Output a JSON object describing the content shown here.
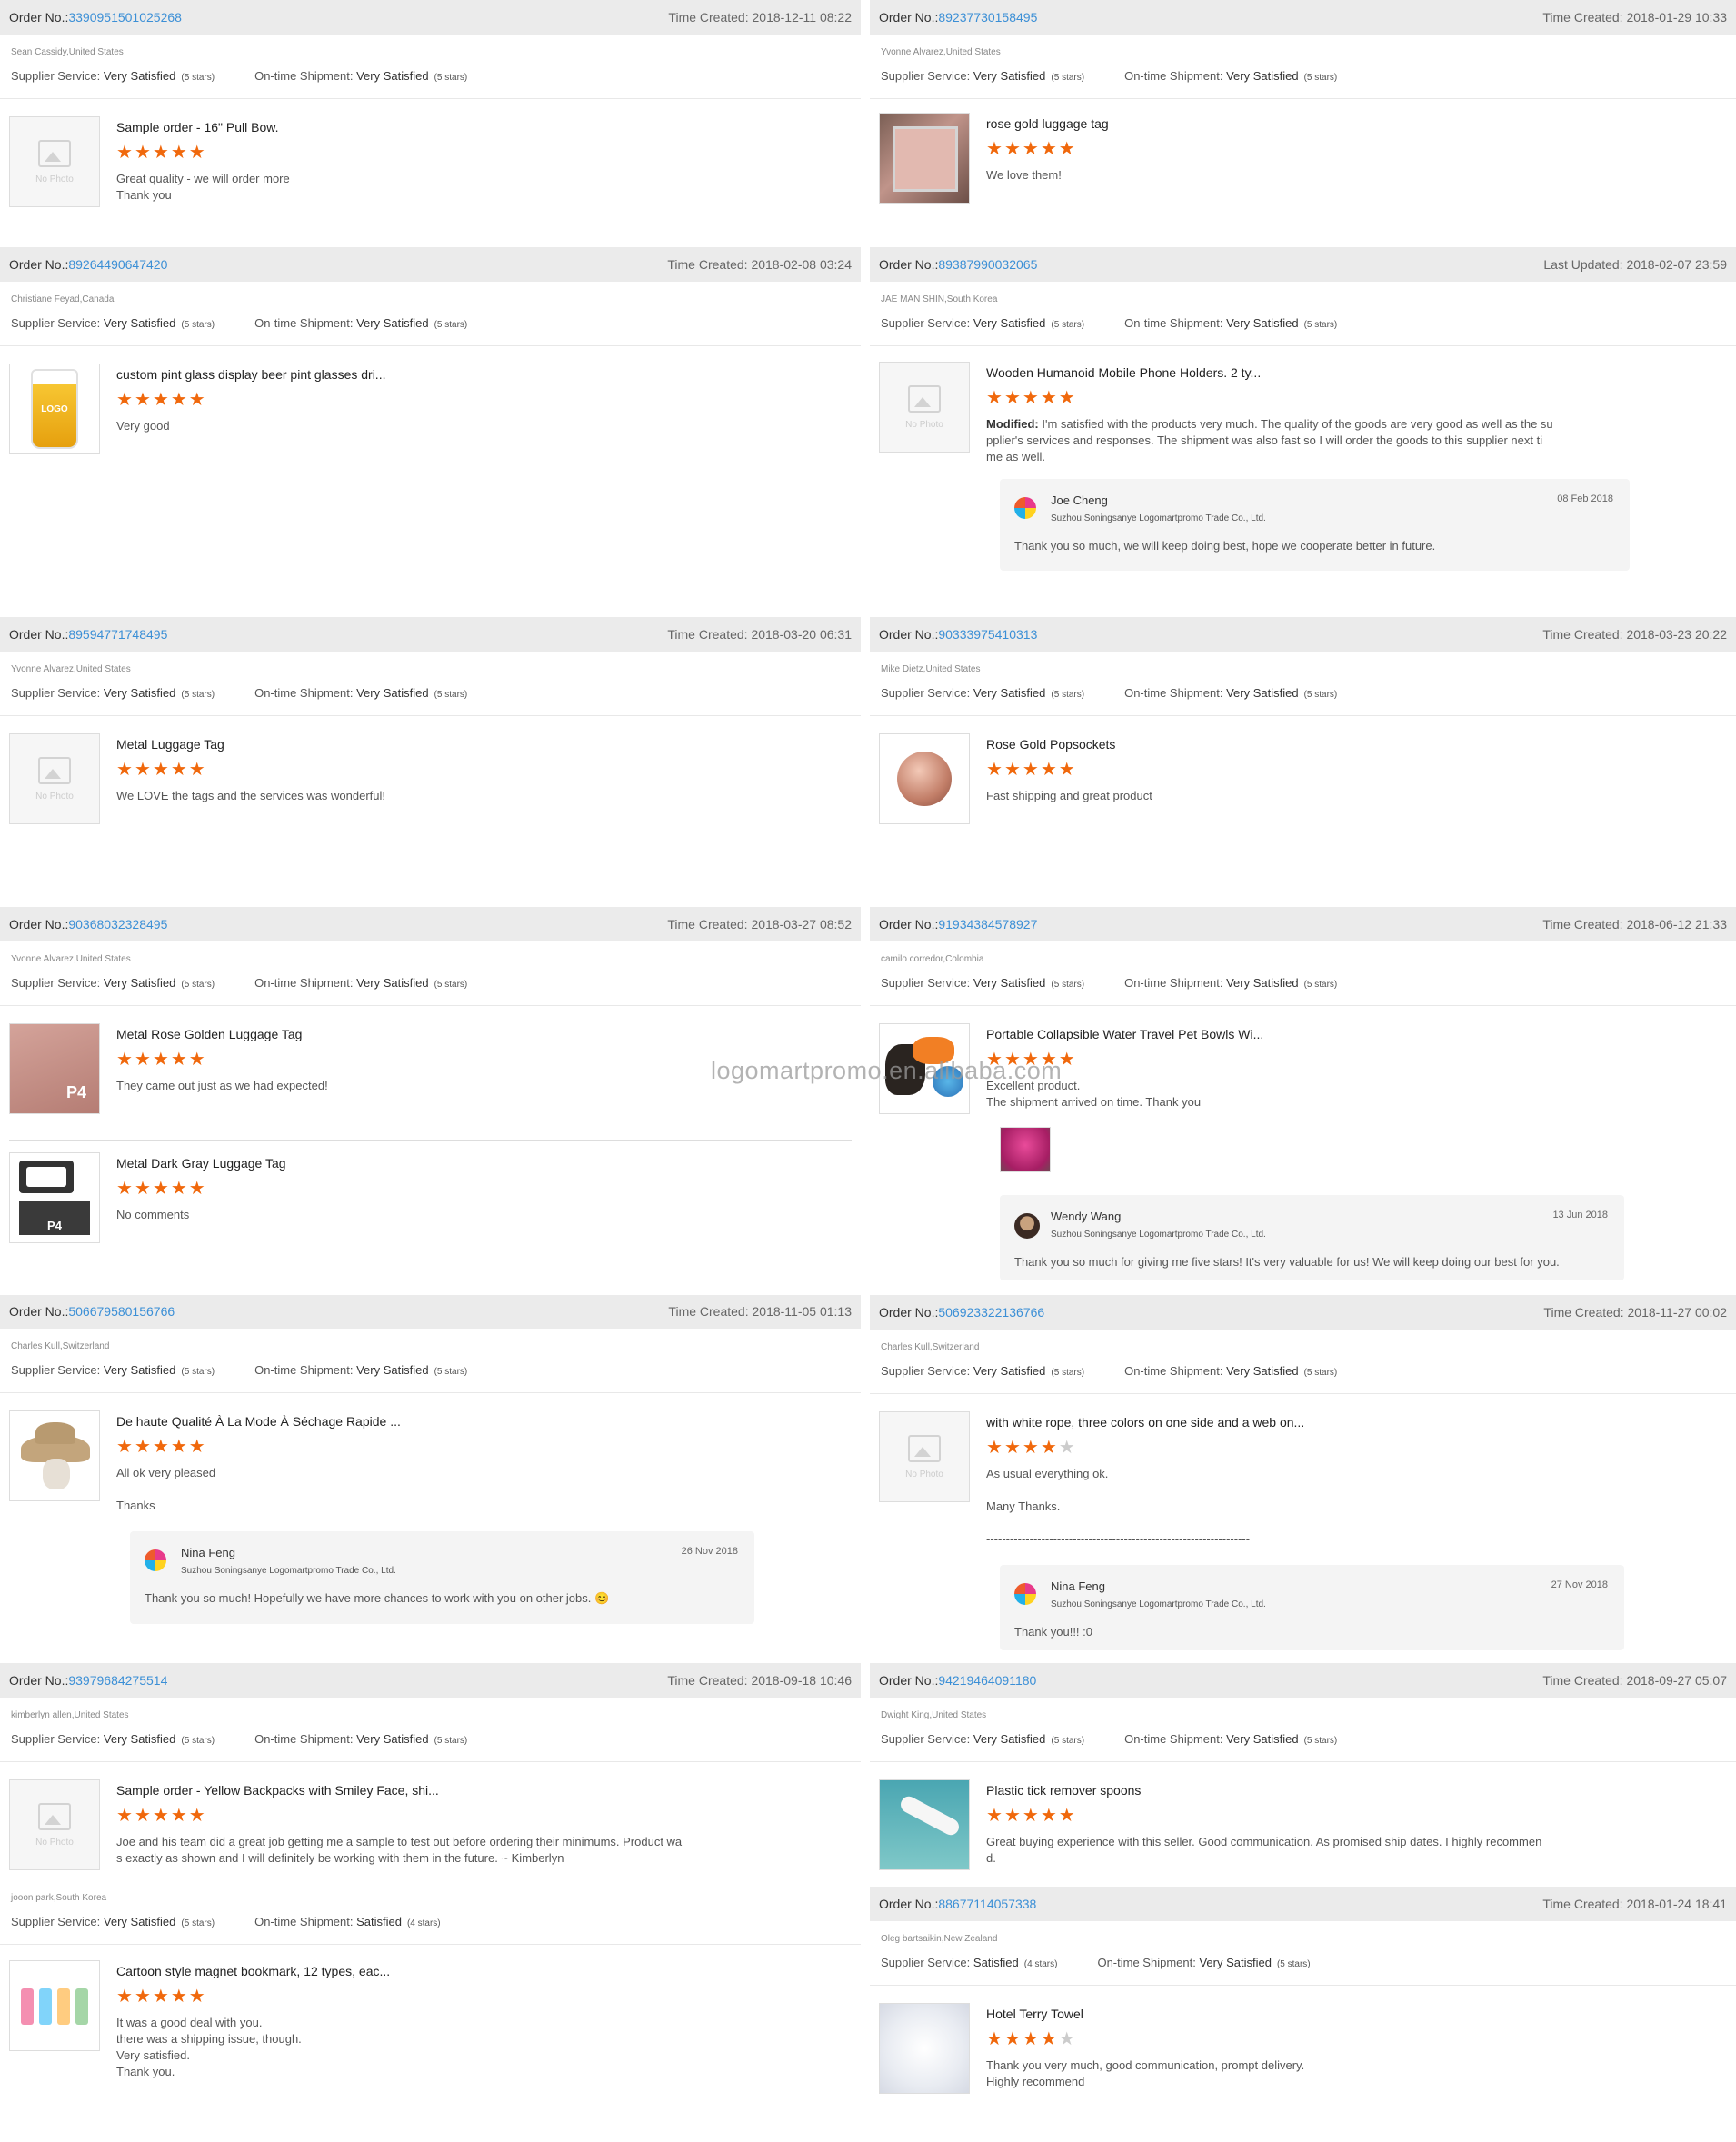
{
  "labels": {
    "order": "Order No.:",
    "supplier": "Supplier Service:",
    "shipment": "On-time Shipment:",
    "company": "Suzhou Soningsanye Logomartpromo Trade Co., Ltd.",
    "nophoto": "No Photo"
  },
  "watermark": "logomartpromo.en.alibaba.com",
  "colors": {
    "accent": "#3b8fd6",
    "star": "#f0680c",
    "header": "#ebebeb"
  },
  "orders": [
    {
      "no": "3390951501025268",
      "timelabel": "Time Created:",
      "time": "2018-12-11 08:22",
      "buyer": "Sean Cassidy,United States",
      "supplier": "Very Satisfied",
      "supplier_stars": "(5 stars)",
      "shipment": "Very Satisfied",
      "shipment_stars": "(5 stars)",
      "items": [
        {
          "title": "Sample order - 16\" Pull Bow.",
          "rating": 5,
          "comment": "Great quality - we will order more\nThank you",
          "image": "no-photo"
        }
      ]
    },
    {
      "no": "89237730158495",
      "timelabel": "Time Created:",
      "time": "2018-01-29 10:33",
      "buyer": "Yvonne Alvarez,United States",
      "supplier": "Very Satisfied",
      "supplier_stars": "(5 stars)",
      "shipment": "Very Satisfied",
      "shipment_stars": "(5 stars)",
      "items": [
        {
          "title": "rose gold luggage tag",
          "rating": 5,
          "comment": "We love them!",
          "image": "luggage-tag-photo"
        }
      ]
    },
    {
      "no": "89264490647420",
      "timelabel": "Time Created:",
      "time": "2018-02-08 03:24",
      "buyer": "Christiane Feyad,Canada",
      "supplier": "Very Satisfied",
      "supplier_stars": "(5 stars)",
      "shipment": "Very Satisfied",
      "shipment_stars": "(5 stars)",
      "items": [
        {
          "title": "custom pint glass display beer pint glasses dri...",
          "rating": 5,
          "comment": "Very good",
          "image": "pint-glass-photo",
          "image_text": "LOGO"
        }
      ]
    },
    {
      "no": "89387990032065",
      "timelabel": "Last Updated:",
      "time": "2018-02-07 23:59",
      "buyer": "JAE MAN SHIN,South Korea",
      "supplier": "Very Satisfied",
      "supplier_stars": "(5 stars)",
      "shipment": "Very Satisfied",
      "shipment_stars": "(5 stars)",
      "items": [
        {
          "title": "Wooden Humanoid Mobile Phone Holders. 2 ty...",
          "rating": 5,
          "comment_prefix": "Modified:",
          "comment": "I'm satisfied with the products very much.  The quality of the goods are very good as well as the su\npplier's services and responses.  The shipment was also fast so I will order the goods to this supplier next ti\nme as well.",
          "image": "no-photo"
        }
      ],
      "reply": {
        "name": "Joe Cheng",
        "date": "08 Feb 2018",
        "text": "Thank you so much, we will keep doing best, hope we cooperate better in future."
      }
    },
    {
      "no": "89594771748495",
      "timelabel": "Time Created:",
      "time": "2018-03-20 06:31",
      "buyer": "Yvonne Alvarez,United States",
      "supplier": "Very Satisfied",
      "supplier_stars": "(5 stars)",
      "shipment": "Very Satisfied",
      "shipment_stars": "(5 stars)",
      "items": [
        {
          "title": "Metal Luggage Tag",
          "rating": 5,
          "comment": "We LOVE the tags and the services was wonderful!",
          "image": "no-photo"
        }
      ]
    },
    {
      "no": "90333975410313",
      "timelabel": "Time Created:",
      "time": "2018-03-23 20:22",
      "buyer": "Mike Dietz,United States",
      "supplier": "Very Satisfied",
      "supplier_stars": "(5 stars)",
      "shipment": "Very Satisfied",
      "shipment_stars": "(5 stars)",
      "items": [
        {
          "title": "Rose Gold Popsockets",
          "rating": 5,
          "comment": "Fast shipping and great product",
          "image": "popsocket-photo"
        }
      ]
    },
    {
      "no": "90368032328495",
      "timelabel": "Time Created:",
      "time": "2018-03-27 08:52",
      "buyer": "Yvonne Alvarez,United States",
      "supplier": "Very Satisfied",
      "supplier_stars": "(5 stars)",
      "shipment": "Very Satisfied",
      "shipment_stars": "(5 stars)",
      "items": [
        {
          "title": "Metal Rose Golden Luggage Tag",
          "rating": 5,
          "comment": "They came out just as we had expected!",
          "image": "rose-tag-photo",
          "image_text": "P4"
        },
        {
          "title": "Metal Dark Gray Luggage Tag",
          "rating": 5,
          "comment": "No comments",
          "image": "gray-tag-photo",
          "image_text": "P4"
        }
      ]
    },
    {
      "no": "91934384578927",
      "timelabel": "Time Created:",
      "time": "2018-06-12 21:33",
      "buyer": "camilo corredor,Colombia",
      "supplier": "Very Satisfied",
      "supplier_stars": "(5 stars)",
      "shipment": "Very Satisfied",
      "shipment_stars": "(5 stars)",
      "items": [
        {
          "title": "Portable Collapsible Water Travel Pet Bowls Wi...",
          "rating": 5,
          "comment": "Excellent product.\nThe shipment arrived on time. Thank you",
          "image": "pet-bowl-photo"
        }
      ],
      "reply": {
        "name": "Wendy Wang",
        "date": "13 Jun 2018",
        "text": "Thank you so much for giving me five stars! It's very valuable for us! We will keep doing our best for you."
      }
    },
    {
      "no": "506679580156766",
      "timelabel": "Time Created:",
      "time": "2018-11-05 01:13",
      "buyer": "Charles Kull,Switzerland",
      "supplier": "Very Satisfied",
      "supplier_stars": "(5 stars)",
      "shipment": "Very Satisfied",
      "shipment_stars": "(5 stars)",
      "items": [
        {
          "title": "De haute Qualité À La Mode À Séchage Rapide ...",
          "rating": 5,
          "comment": "All ok very pleased\n\nThanks",
          "image": "hat-photo"
        }
      ],
      "reply": {
        "name": "Nina Feng",
        "date": "26 Nov 2018",
        "text": "Thank you so much! Hopefully we have more chances to work with you on other jobs. 😊"
      }
    },
    {
      "no": "506923322136766",
      "timelabel": "Time Created:",
      "time": "2018-11-27 00:02",
      "buyer": "Charles Kull,Switzerland",
      "supplier": "Very Satisfied",
      "supplier_stars": "(5 stars)",
      "shipment": "Very Satisfied",
      "shipment_stars": "(5 stars)",
      "items": [
        {
          "title": "with white rope, three colors on one side and a web on...",
          "rating": 4,
          "comment": "As usual everything ok.\n\nMany Thanks.\n\n-------------------------------------------------------------------",
          "image": "no-photo"
        }
      ],
      "reply": {
        "name": "Nina Feng",
        "date": "27 Nov 2018",
        "text": "Thank you!!!  :0"
      }
    },
    {
      "no": "93979684275514",
      "timelabel": "Time Created:",
      "time": "2018-09-18 10:46",
      "buyer": "kimberlyn allen,United States",
      "supplier": "Very Satisfied",
      "supplier_stars": "(5 stars)",
      "shipment": "Very Satisfied",
      "shipment_stars": "(5 stars)",
      "items": [
        {
          "title": "Sample order - Yellow Backpacks with Smiley Face, shi...",
          "rating": 5,
          "comment": "Joe and his team did a great job getting me a sample to test out before ordering their minimums. Product wa\ns exactly as shown and I will definitely be working with them in the future. ~ Kimberlyn",
          "image": "no-photo"
        }
      ]
    },
    {
      "no": "94219464091180",
      "timelabel": "Time Created:",
      "time": "2018-09-27 05:07",
      "buyer": "Dwight King,United States",
      "supplier": "Very Satisfied",
      "supplier_stars": "(5 stars)",
      "shipment": "Very Satisfied",
      "shipment_stars": "(5 stars)",
      "items": [
        {
          "title": "Plastic tick remover spoons",
          "rating": 5,
          "comment": "Great buying experience with this seller. Good communication. As promised ship dates. I highly recommen\nd.",
          "image": "spoon-photo"
        }
      ]
    },
    {
      "no": "",
      "timelabel": "",
      "time": "",
      "buyer": "jooon park,South Korea",
      "supplier": "Very Satisfied",
      "supplier_stars": "(5 stars)",
      "shipment": "Satisfied",
      "shipment_stars": "(4 stars)",
      "items": [
        {
          "title": "Cartoon style magnet bookmark, 12 types, eac...",
          "rating": 5,
          "comment": "It was a good deal with you.\nthere was a shipping issue, though.\nVery satisfied.\nThank you.",
          "image": "bookmark-photo"
        }
      ]
    },
    {
      "no": "88677114057338",
      "timelabel": "Time Created:",
      "time": "2018-01-24 18:41",
      "buyer": "Oleg bartsaikin,New Zealand",
      "supplier": "Satisfied",
      "supplier_stars": "(4 stars)",
      "shipment": "Very Satisfied",
      "shipment_stars": "(5 stars)",
      "items": [
        {
          "title": "Hotel Terry Towel",
          "rating": 4,
          "comment": "Thank you very much, good communication, prompt delivery.\nHighly recommend",
          "image": "towel-photo"
        }
      ]
    }
  ]
}
